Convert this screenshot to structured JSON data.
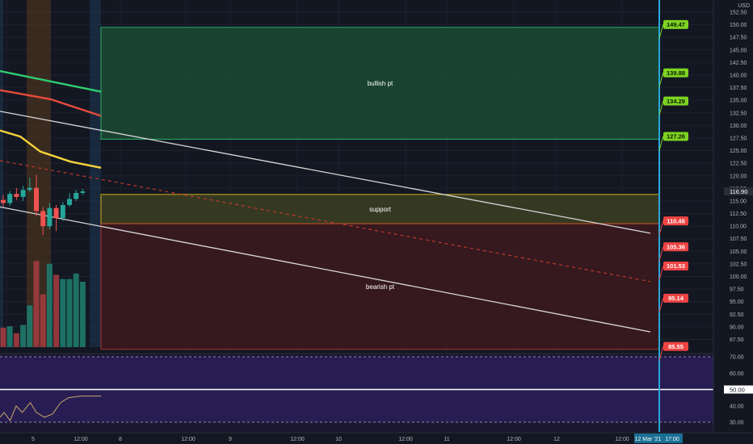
{
  "chart_data": {
    "type": "candlestick",
    "currency": "USD",
    "y_ticks": [
      "152.50",
      "150.00",
      "147.50",
      "145.00",
      "142.50",
      "140.00",
      "137.50",
      "135.00",
      "132.50",
      "130.00",
      "127.50",
      "125.00",
      "122.50",
      "120.00",
      "117.50",
      "115.00",
      "112.50",
      "110.00",
      "107.50",
      "105.00",
      "102.50",
      "100.00",
      "97.50",
      "95.00",
      "92.50",
      "90.00",
      "87.50"
    ],
    "ylim": [
      86.0,
      153.8
    ],
    "current_price": "116.90",
    "x_ticks": [
      "5",
      "12:00",
      "8",
      "12:00",
      "9",
      "12:00",
      "10",
      "12:00",
      "11",
      "12:00",
      "12",
      "12:00"
    ],
    "x_highlight": {
      "date": "12 Mar '21",
      "time": "17:00"
    },
    "zones": [
      {
        "label": "bullish pt",
        "from": 127.26,
        "to": 149.47,
        "fill": "#1b4a34",
        "stroke": "#2ecc71"
      },
      {
        "label": "support",
        "from": 110.48,
        "to": 116.3,
        "fill": "#3d3f23",
        "stroke": "#f0c419"
      },
      {
        "label": "bearish pt",
        "from": 85.55,
        "to": 110.48,
        "fill": "#3b1a1f",
        "stroke": "#c0392b"
      }
    ],
    "price_tags": [
      {
        "value": "149.47",
        "y": 149.47,
        "kind": "bull"
      },
      {
        "value": "139.88",
        "y": 139.88,
        "kind": "bull"
      },
      {
        "value": "134.29",
        "y": 134.29,
        "kind": "bull"
      },
      {
        "value": "127.26",
        "y": 127.26,
        "kind": "bull"
      },
      {
        "value": "110.48",
        "y": 110.48,
        "kind": "bear"
      },
      {
        "value": "105.36",
        "y": 105.36,
        "kind": "bear"
      },
      {
        "value": "101.53",
        "y": 101.53,
        "kind": "bear"
      },
      {
        "value": "95.14",
        "y": 95.14,
        "kind": "bear"
      },
      {
        "value": "85.55",
        "y": 85.55,
        "kind": "bear"
      }
    ],
    "candles": [
      {
        "o": 115.2,
        "h": 116.2,
        "l": 113.8,
        "c": 114.6
      },
      {
        "o": 114.6,
        "h": 117.0,
        "l": 114.0,
        "c": 116.4
      },
      {
        "o": 116.4,
        "h": 117.6,
        "l": 115.2,
        "c": 115.8
      },
      {
        "o": 115.8,
        "h": 118.0,
        "l": 115.0,
        "c": 117.2
      },
      {
        "o": 117.2,
        "h": 119.6,
        "l": 116.8,
        "c": 117.6
      },
      {
        "o": 117.6,
        "h": 120.2,
        "l": 112.0,
        "c": 113.0
      },
      {
        "o": 113.0,
        "h": 113.8,
        "l": 108.2,
        "c": 110.0
      },
      {
        "o": 110.0,
        "h": 114.6,
        "l": 109.4,
        "c": 113.6
      },
      {
        "o": 113.6,
        "h": 114.2,
        "l": 109.0,
        "c": 111.6
      },
      {
        "o": 111.6,
        "h": 114.8,
        "l": 111.0,
        "c": 114.2
      },
      {
        "o": 114.2,
        "h": 116.6,
        "l": 113.8,
        "c": 115.4
      },
      {
        "o": 115.4,
        "h": 117.2,
        "l": 115.0,
        "c": 116.6
      },
      {
        "o": 116.6,
        "h": 117.4,
        "l": 116.2,
        "c": 116.9
      }
    ],
    "volume": [
      0.14,
      0.15,
      0.1,
      0.16,
      0.3,
      0.62,
      0.38,
      0.6,
      0.52,
      0.49,
      0.49,
      0.53,
      0.47
    ],
    "lines": [
      {
        "type": "ema",
        "color": "#2ecc71",
        "points": [
          [
            0,
            140.8
          ],
          [
            0.5,
            136.7
          ]
        ]
      },
      {
        "type": "ema",
        "color": "#e74c3c",
        "points": [
          [
            0,
            137.0
          ],
          [
            0.25,
            135.2
          ],
          [
            0.5,
            131.9
          ]
        ]
      },
      {
        "type": "ema",
        "color": "#f5d43b",
        "points": [
          [
            0,
            129.0
          ],
          [
            0.1,
            127.8
          ],
          [
            0.2,
            124.8
          ],
          [
            0.35,
            122.8
          ],
          [
            0.5,
            121.6
          ]
        ]
      },
      {
        "type": "trend",
        "color": "#d8d8d8",
        "points": [
          [
            0,
            132.8
          ],
          [
            3.0,
            108.6
          ]
        ]
      },
      {
        "type": "trend",
        "color": "#d8d8d8",
        "points": [
          [
            0,
            113.8
          ],
          [
            3.0,
            89.0
          ]
        ]
      },
      {
        "type": "dashed",
        "color": "#c0392b",
        "points": [
          [
            0,
            123.0
          ],
          [
            3.0,
            99.0
          ]
        ]
      }
    ],
    "rsi": {
      "ticks": [
        "70.00",
        "60.00",
        "50.00",
        "40.00",
        "30.00"
      ],
      "mid_label": "50.00",
      "points": [
        [
          0,
          33
        ],
        [
          0.02,
          36
        ],
        [
          0.05,
          31
        ],
        [
          0.08,
          40
        ],
        [
          0.11,
          36
        ],
        [
          0.15,
          42
        ],
        [
          0.18,
          36
        ],
        [
          0.22,
          33
        ],
        [
          0.26,
          35
        ],
        [
          0.3,
          42
        ],
        [
          0.34,
          45
        ],
        [
          0.4,
          46
        ],
        [
          0.5,
          46
        ]
      ]
    }
  }
}
